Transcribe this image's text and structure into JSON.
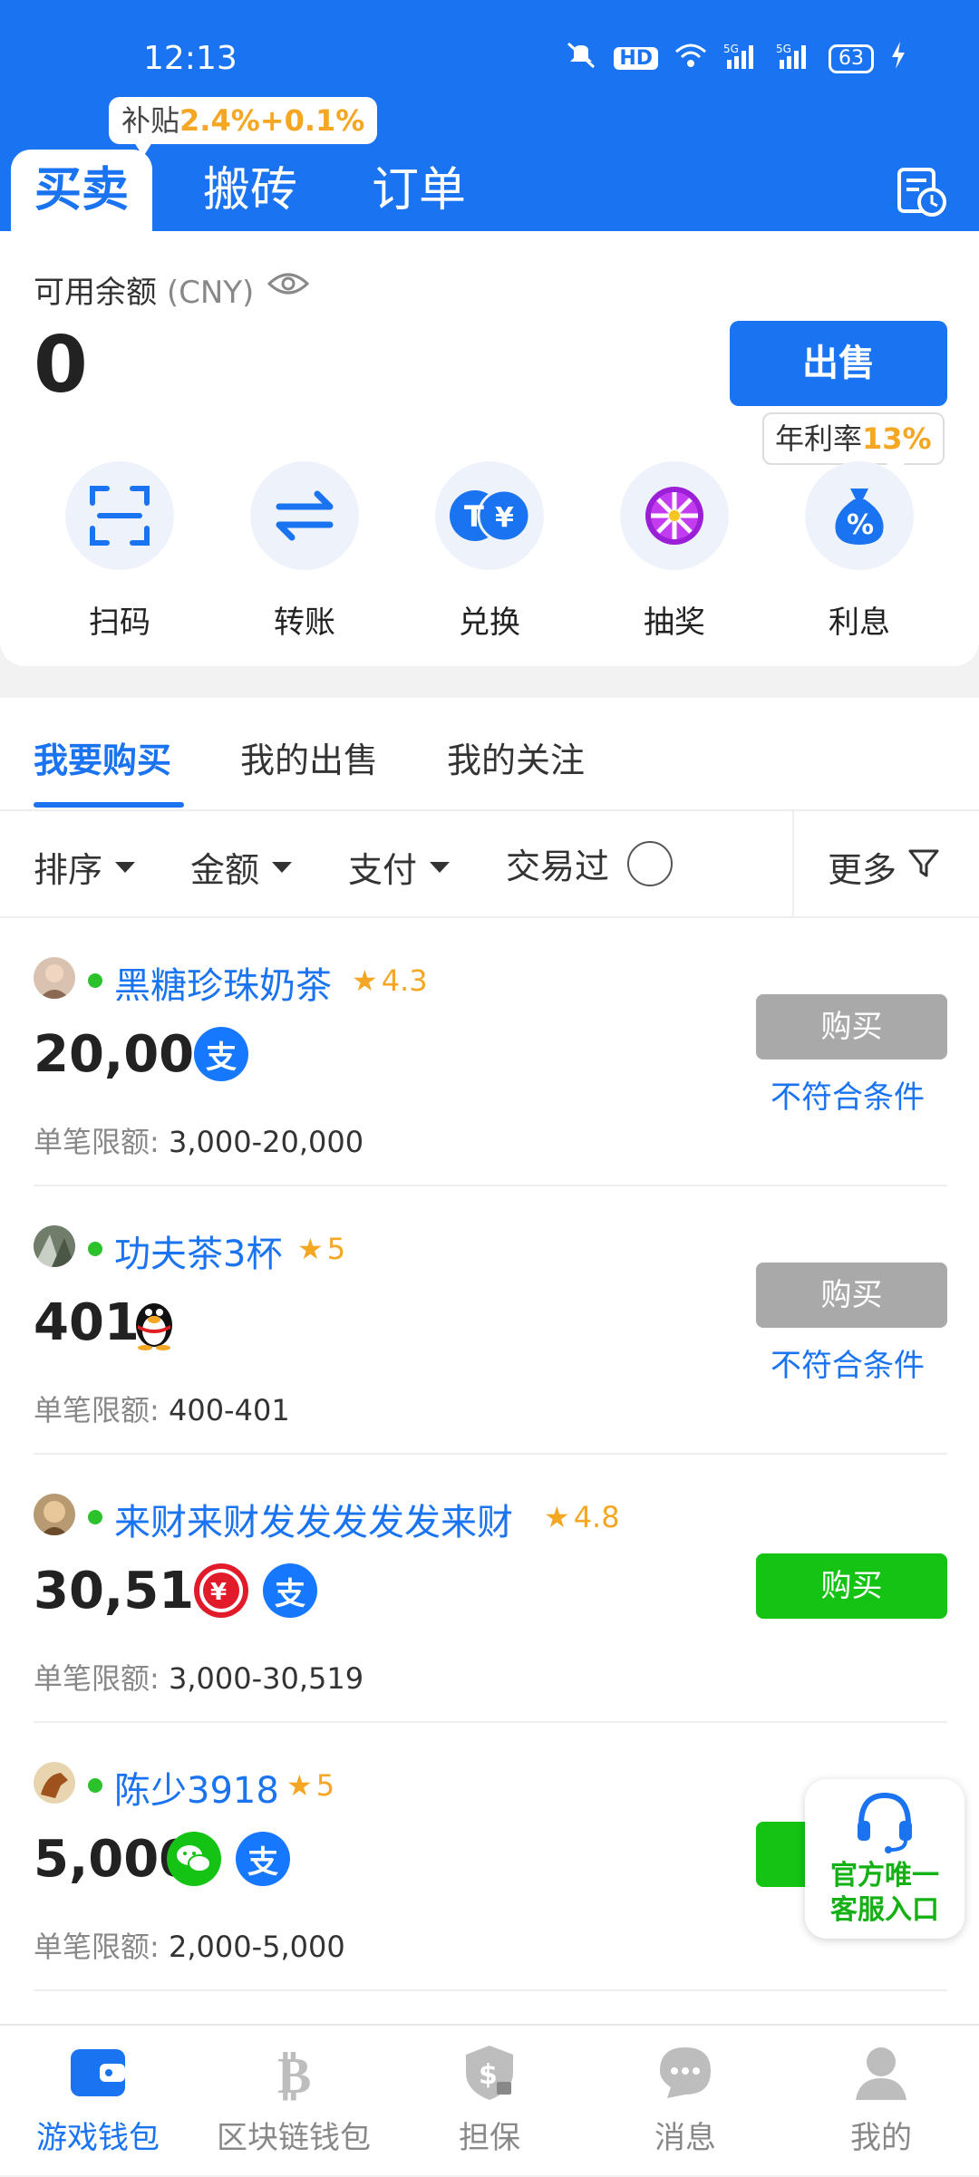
{
  "status_bar": {
    "time": "12:13",
    "network": "5G",
    "battery": "63"
  },
  "header": {
    "tabs": [
      "买卖",
      "搬砖",
      "订单"
    ],
    "subsidy_label": "补贴",
    "subsidy_value": "2.4%+0.1%"
  },
  "balance": {
    "label": "可用余额",
    "currency": "(CNY)",
    "value": "0",
    "sell_button": "出售",
    "rate_label": "年利率",
    "rate_value": "13%"
  },
  "actions": [
    {
      "label": "扫码",
      "icon": "scan-icon"
    },
    {
      "label": "转账",
      "icon": "transfer-icon"
    },
    {
      "label": "兑换",
      "icon": "exchange-icon"
    },
    {
      "label": "抽奖",
      "icon": "lottery-wheel-icon"
    },
    {
      "label": "利息",
      "icon": "interest-bag-icon"
    }
  ],
  "list_tabs": [
    "我要购买",
    "我的出售",
    "我的关注"
  ],
  "filters": {
    "sort": "排序",
    "amount": "金额",
    "payment": "支付",
    "traded": "交易过",
    "more": "更多"
  },
  "listings": [
    {
      "seller": "黑糖珍珠奶茶",
      "rating": "4.3",
      "amount": "20,000",
      "payments": [
        "alipay"
      ],
      "limit_label": "单笔限额:",
      "limit": "3,000-20,000",
      "button": "购买",
      "note": "不符合条件",
      "enabled": false
    },
    {
      "seller": "功夫茶3杯",
      "rating": "5",
      "amount": "401",
      "payments": [
        "qq"
      ],
      "limit_label": "单笔限额:",
      "limit": "400-401",
      "button": "购买",
      "note": "不符合条件",
      "enabled": false
    },
    {
      "seller": "来财来财发发发发发来财",
      "rating": "4.8",
      "amount": "30,519",
      "payments": [
        "unionpay",
        "alipay"
      ],
      "limit_label": "单笔限额:",
      "limit": "3,000-30,519",
      "button": "购买",
      "note": "",
      "enabled": true
    },
    {
      "seller": "陈少3918",
      "rating": "5",
      "amount": "5,000",
      "payments": [
        "wechat",
        "alipay"
      ],
      "limit_label": "单笔限额:",
      "limit": "2,000-5,000",
      "button": "购买",
      "note": "",
      "enabled": true
    }
  ],
  "service_float": {
    "line1": "官方唯一",
    "line2": "客服入口"
  },
  "bottom_nav": [
    {
      "label": "游戏钱包",
      "icon": "wallet-icon",
      "active": true
    },
    {
      "label": "区块链钱包",
      "icon": "bitcoin-icon",
      "active": false
    },
    {
      "label": "担保",
      "icon": "shield-dollar-icon",
      "active": false
    },
    {
      "label": "消息",
      "icon": "chat-bubble-icon",
      "active": false
    },
    {
      "label": "我的",
      "icon": "user-icon",
      "active": false
    }
  ],
  "colors": {
    "primary": "#1a73f0",
    "accent": "#f5a623",
    "green": "#14c314",
    "disabled": "#a9a9a9"
  }
}
